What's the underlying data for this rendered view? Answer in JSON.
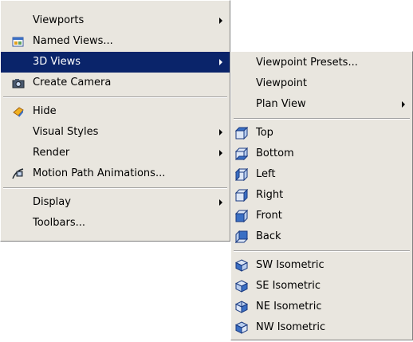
{
  "main_menu": {
    "viewports": "Viewports",
    "named_views": "Named Views...",
    "views_3d": "3D Views",
    "create_camera": "Create Camera",
    "hide": "Hide",
    "visual_styles": "Visual Styles",
    "render": "Render",
    "motion_path": "Motion Path Animations...",
    "display": "Display",
    "toolbars": "Toolbars..."
  },
  "sub_menu": {
    "viewpoint_presets": "Viewpoint Presets...",
    "viewpoint": "Viewpoint",
    "plan_view": "Plan View",
    "top": "Top",
    "bottom": "Bottom",
    "left": "Left",
    "right": "Right",
    "front": "Front",
    "back": "Back",
    "sw_iso": "SW Isometric",
    "se_iso": "SE Isometric",
    "ne_iso": "NE Isometric",
    "nw_iso": "NW Isometric"
  },
  "colors": {
    "menu_bg": "#e9e6df",
    "highlight_bg": "#0a246a",
    "highlight_text": "#ffffff",
    "cube_face": "#3a6fc4",
    "cube_top": "#8fb4ee"
  },
  "icons": {
    "named_views": "named-views-icon",
    "create_camera": "camera-icon",
    "hide": "hide-icon",
    "motion_path": "motion-path-icon",
    "top": "view-top-icon",
    "bottom": "view-bottom-icon",
    "left": "view-left-icon",
    "right": "view-right-icon",
    "front": "view-front-icon",
    "back": "view-back-icon",
    "sw_iso": "sw-isometric-icon",
    "se_iso": "se-isometric-icon",
    "ne_iso": "ne-isometric-icon",
    "nw_iso": "nw-isometric-icon"
  }
}
